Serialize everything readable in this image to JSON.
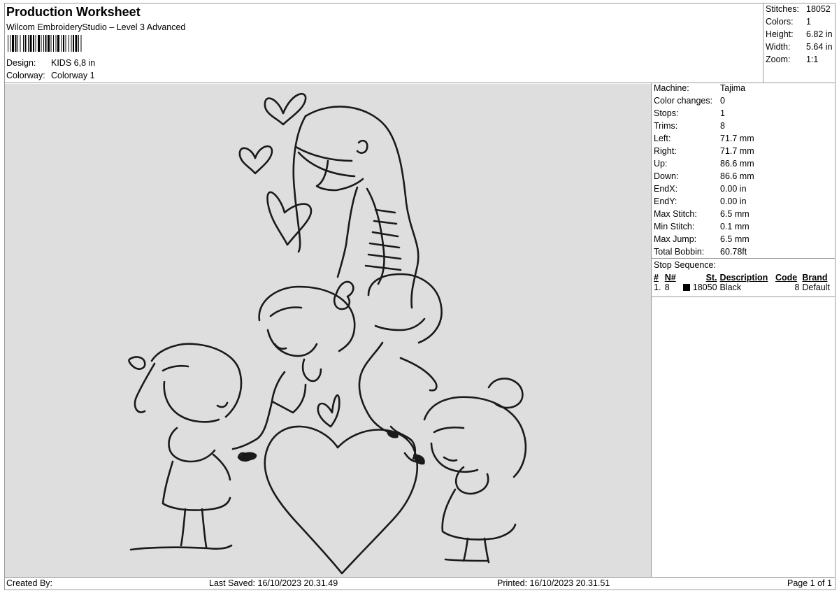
{
  "header": {
    "title": "Production Worksheet",
    "subtitle": "Wilcom EmbroideryStudio – Level 3 Advanced",
    "design_label": "Design:",
    "design_value": "KIDS 6,8 in",
    "colorway_label": "Colorway:",
    "colorway_value": "Colorway 1"
  },
  "summary": [
    {
      "label": "Stitches:",
      "value": "18052"
    },
    {
      "label": "Colors:",
      "value": "1"
    },
    {
      "label": "Height:",
      "value": "6.82 in"
    },
    {
      "label": "Width:",
      "value": "5.64 in"
    },
    {
      "label": "Zoom:",
      "value": "1:1"
    }
  ],
  "machine_info": [
    {
      "label": "Machine:",
      "value": "Tajima"
    },
    {
      "label": "Color changes:",
      "value": "0"
    },
    {
      "label": "Stops:",
      "value": "1"
    },
    {
      "label": "Trims:",
      "value": "8"
    },
    {
      "label": "Left:",
      "value": "71.7 mm"
    },
    {
      "label": "Right:",
      "value": "71.7 mm"
    },
    {
      "label": "Up:",
      "value": "86.6 mm"
    },
    {
      "label": "Down:",
      "value": "86.6 mm"
    },
    {
      "label": "EndX:",
      "value": "0.00 in"
    },
    {
      "label": "EndY:",
      "value": "0.00 in"
    },
    {
      "label": "Max Stitch:",
      "value": "6.5 mm"
    },
    {
      "label": "Min Stitch:",
      "value": "0.1 mm"
    },
    {
      "label": "Max Jump:",
      "value": "6.5 mm"
    },
    {
      "label": "Total Bobbin:",
      "value": "60.78ft"
    }
  ],
  "stop_sequence": {
    "label": "Stop Sequence:",
    "columns": [
      "#",
      "N#",
      "St.",
      "Description",
      "Code",
      "Brand"
    ],
    "rows": [
      {
        "num": "1.",
        "n": "8",
        "st": "18050",
        "desc": "Black",
        "code": "8",
        "brand": "Default",
        "color": "#000000"
      }
    ]
  },
  "footer": {
    "created": "Created By:",
    "saved": "Last Saved: 16/10/2023 20.31.49",
    "printed": "Printed: 16/10/2023 20.31.51",
    "page": "Page 1 of 1"
  },
  "colors": {
    "canvas": "#dedede",
    "thread": "#1a1a1a",
    "border": "#9a9a9a"
  }
}
